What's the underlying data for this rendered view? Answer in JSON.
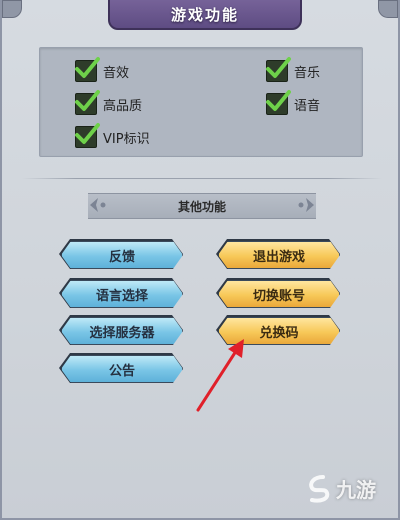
{
  "header": {
    "title": "游戏功能"
  },
  "settings": [
    {
      "label": "音效",
      "checked": true
    },
    {
      "label": "音乐",
      "checked": true
    },
    {
      "label": "高品质",
      "checked": true
    },
    {
      "label": "语音",
      "checked": true
    },
    {
      "label": "VIP标识",
      "checked": true
    }
  ],
  "section": {
    "title": "其他功能"
  },
  "buttons": {
    "feedback": "反馈",
    "language": "语言选择",
    "server": "选择服务器",
    "notice": "公告",
    "exit_game": "退出游戏",
    "switch_account": "切换账号",
    "redeem_code": "兑换码"
  },
  "watermark": {
    "text": "九游"
  },
  "colors": {
    "title_bar": "#6b5a91",
    "blue_button": "#79c5e6",
    "gold_button": "#f7c858",
    "checkmark": "#6ed14a",
    "annotation_arrow": "#e0202a"
  }
}
